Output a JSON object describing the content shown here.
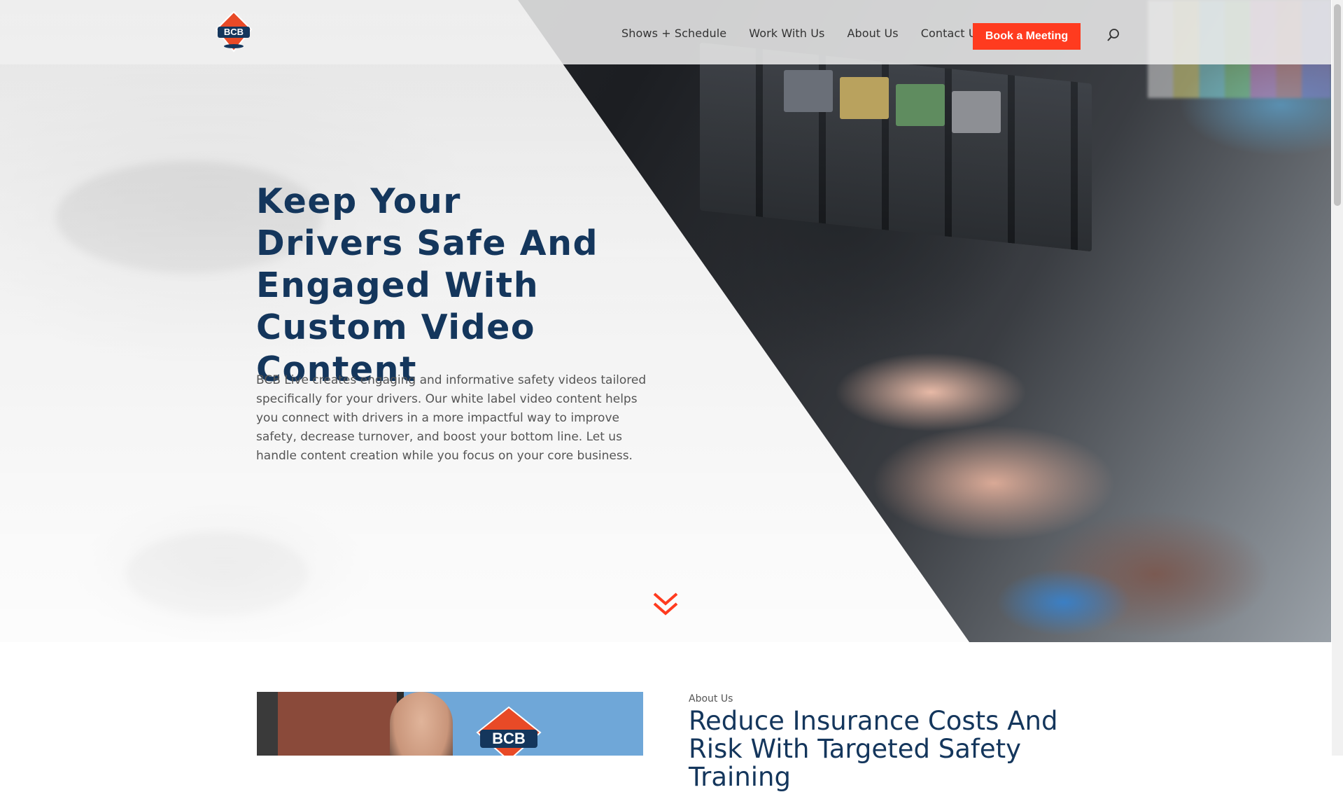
{
  "header": {
    "logo_text": "BCB",
    "nav": [
      {
        "label": "Shows + Schedule"
      },
      {
        "label": "Work With Us"
      },
      {
        "label": "About Us"
      },
      {
        "label": "Contact Us"
      }
    ],
    "cta_label": "Book a Meeting",
    "search_icon": "search-icon"
  },
  "hero": {
    "title": "Keep Your Drivers Safe And Engaged With Custom Video Content",
    "description": "BCB Live creates engaging and informative safety videos tailored specifically for your drivers. Our white label video content helps you connect with drivers in a more impactful way to improve safety, decrease turnover, and boost your bottom line. Let us handle content creation while you focus on your core business.",
    "scroll_icon": "double-chevron-down-icon"
  },
  "about": {
    "kicker": "About Us",
    "title": "Reduce Insurance Costs And Risk With Targeted Safety Training",
    "image_logo_text": "BCB"
  },
  "colors": {
    "accent": "#ff3b1f",
    "heading": "#14365c"
  }
}
